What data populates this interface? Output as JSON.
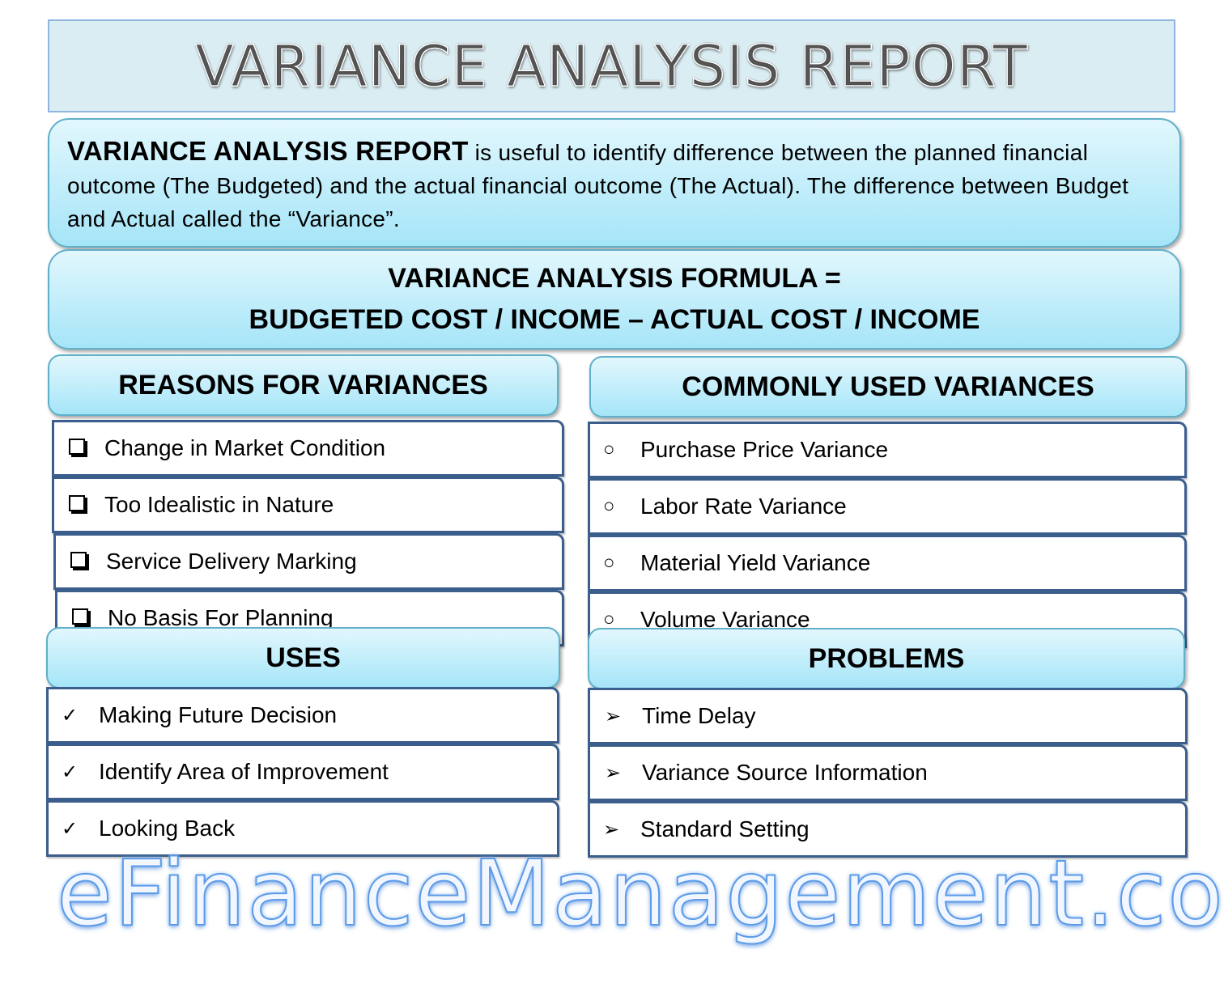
{
  "title": "VARIANCE ANALYSIS REPORT",
  "intro": {
    "bold": "VARIANCE ANALYSIS REPORT",
    "text": " is useful to identify difference between the planned financial outcome (The Budgeted) and the actual financial outcome (The Actual). The difference between Budget and Actual called the “Variance”."
  },
  "formula": {
    "line1": "VARIANCE ANALYSIS FORMULA =",
    "line2": "BUDGETED COST / INCOME – ACTUAL COST / INCOME"
  },
  "reasons": {
    "header": "REASONS FOR VARIANCES",
    "bullet_icon": "checkbox-square-icon",
    "items": [
      "Change in Market Condition",
      "Too Idealistic in Nature",
      "Service Delivery Marking",
      "No Basis For Planning"
    ]
  },
  "common": {
    "header": "COMMONLY USED VARIANCES",
    "bullet": "○",
    "items": [
      "Purchase Price Variance",
      "Labor Rate Variance",
      "Material Yield Variance",
      "Volume Variance"
    ]
  },
  "uses": {
    "header": "USES",
    "bullet": "✓",
    "items": [
      "Making Future Decision",
      "Identify Area of Improvement",
      "Looking Back"
    ]
  },
  "problems": {
    "header": "PROBLEMS",
    "bullet": "➢",
    "items": [
      "Time Delay",
      "Variance Source Information",
      "Standard Setting"
    ]
  },
  "brand": "eFinanceManagement.com",
  "colors": {
    "title_bg": "#daedf3",
    "pill_top": "#e2f7fd",
    "pill_bottom": "#a5e5f8",
    "row_border": "#3b5e8c",
    "brand_outline": "#5c9be8"
  }
}
